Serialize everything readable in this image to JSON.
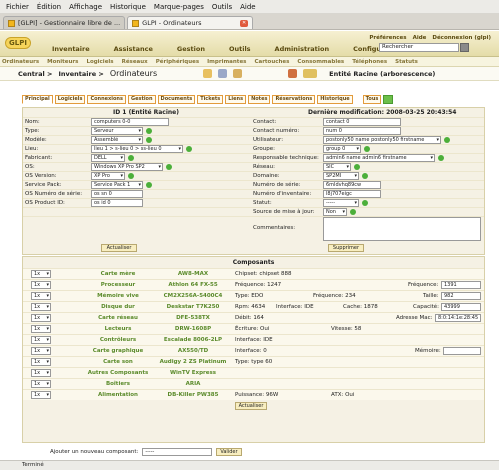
{
  "browser_menu": [
    "Fichier",
    "Édition",
    "Affichage",
    "Historique",
    "Marque-pages",
    "Outils",
    "Aide"
  ],
  "browser_tabs": [
    {
      "title": "[GLPI] - Gestionnaire libre de ..."
    },
    {
      "title": "GLPI - Ordinateurs"
    }
  ],
  "header": {
    "logo": "GLPI",
    "main_nav": [
      "Inventaire",
      "Assistance",
      "Gestion",
      "Outils",
      "Administration",
      "Configuration"
    ],
    "top_links": [
      "Préférences",
      "Aide",
      "Déconnexion (glpi)"
    ],
    "search_placeholder": "Rechercher"
  },
  "subnav": [
    "Ordinateurs",
    "Moniteurs",
    "Logiciels",
    "Réseaux",
    "Périphériques",
    "Imprimantes",
    "Cartouches",
    "Consommables",
    "Téléphones",
    "Statuts"
  ],
  "breadcrumb": {
    "central": "Central >",
    "inventaire": "Inventaire >",
    "section": "Ordinateurs",
    "entity": "Entité Racine (arborescence)"
  },
  "item_tabs": [
    "Principal",
    "Logiciels",
    "Connexions",
    "Gestion",
    "Documents",
    "Tickets",
    "Liens",
    "Notes",
    "Réservations",
    "Historique",
    "Tous"
  ],
  "form": {
    "id_title": "ID 1 (Entité Racine)",
    "last_modified": "Dernière modification: 2008-03-25 20:43:54",
    "left": [
      {
        "label": "Nom:",
        "value": "computers 0-0",
        "kind": "input"
      },
      {
        "label": "Type:",
        "value": "Serveur",
        "kind": "select"
      },
      {
        "label": "Modèle:",
        "value": "Assemblé",
        "kind": "select"
      },
      {
        "label": "Lieu:",
        "value": "lieu 1 > s-lieu 0 > ss-lieu 0",
        "kind": "select"
      },
      {
        "label": "Fabricant:",
        "value": "DELL",
        "kind": "select"
      },
      {
        "label": "OS:",
        "value": "Windows XP Pro SP2",
        "kind": "select"
      },
      {
        "label": "OS Version:",
        "value": "XP Pro",
        "kind": "select"
      },
      {
        "label": "Service Pack:",
        "value": "Service Pack 1",
        "kind": "select"
      },
      {
        "label": "OS Numéro de série:",
        "value": "os sn 0",
        "kind": "input"
      },
      {
        "label": "OS Product ID:",
        "value": "os id 0",
        "kind": "input"
      }
    ],
    "right": [
      {
        "label": "Contact:",
        "value": "contact 0",
        "kind": "input"
      },
      {
        "label": "Contact numéro:",
        "value": "num 0",
        "kind": "input"
      },
      {
        "label": "Utilisateur:",
        "value": "postonly50 name postonly50 firstname",
        "kind": "select"
      },
      {
        "label": "Groupe:",
        "value": "group 0",
        "kind": "select"
      },
      {
        "label": "Responsable technique:",
        "value": "admin6 name admin6 firstname",
        "kind": "select"
      },
      {
        "label": "Réseau:",
        "value": "SIC",
        "kind": "select"
      },
      {
        "label": "Domaine:",
        "value": "SP2MI",
        "kind": "select"
      },
      {
        "label": "Numéro de série:",
        "value": "6mldvhq89cw",
        "kind": "input"
      },
      {
        "label": "Numéro d'inventaire:",
        "value": "l8j707eigc",
        "kind": "input"
      },
      {
        "label": "Statut:",
        "value": "-----",
        "kind": "select"
      },
      {
        "label": "Source de mise à jour:",
        "value": "Non",
        "kind": "select"
      }
    ],
    "comments_label": "Commentaires:",
    "update_button": "Actualiser",
    "delete_button": "Supprimer"
  },
  "components": {
    "title": "Composants",
    "rows": [
      {
        "qty": "1x",
        "type": "Carte mère",
        "name": "AW8-MAX",
        "specs": "Chipset: chipset 888"
      },
      {
        "qty": "1x",
        "type": "Processeur",
        "name": "Athlon 64 FX-55",
        "specs": "Fréquence: 1247",
        "right_label": "Fréquence:",
        "right_value": "1391"
      },
      {
        "qty": "1x",
        "type": "Mémoire vive",
        "name": "CM2X256A-5400C4",
        "specs": "Type: EDO",
        "mid": "Fréquence: 234",
        "right_label": "Taille:",
        "right_value": "982"
      },
      {
        "qty": "1x",
        "type": "Disque dur",
        "name": "Deskstar T7K250",
        "specs": "Rpm: 4634",
        "mid": "Interface: IDE",
        "mid2": "Cache: 1878",
        "right_label": "Capacité:",
        "right_value": "43999"
      },
      {
        "qty": "1x",
        "type": "Carte réseau",
        "name": "DFE-538TX",
        "specs": "Débit: 164",
        "right_label": "Adresse Mac:",
        "right_value": "8:0:14:1e:28:45"
      },
      {
        "qty": "1x",
        "type": "Lecteurs",
        "name": "DRW-1608P",
        "specs": "Écriture: Oui",
        "mid": "Vitesse: 58"
      },
      {
        "qty": "1x",
        "type": "Contrôleurs",
        "name": "Escalade 8006-2LP",
        "specs": "Interface: IDE"
      },
      {
        "qty": "1x",
        "type": "Carte graphique",
        "name": "AX550/TD",
        "specs": "Interface: 0",
        "right_label": "Mémoire:",
        "right_value": ""
      },
      {
        "qty": "1x",
        "type": "Carte son",
        "name": "Audigy 2 ZS Platinum",
        "specs": "Type: type 60"
      },
      {
        "qty": "1x",
        "type": "Autres Composants",
        "name": "WinTV Express",
        "specs": ""
      },
      {
        "qty": "1x",
        "type": "Boîtiers",
        "name": "ARIA",
        "specs": ""
      },
      {
        "qty": "1x",
        "type": "Alimentation",
        "name": "DB-Killer PW385",
        "specs": "Puissance: 96W",
        "mid": "ATX: Oui"
      }
    ],
    "update_button": "Actualiser",
    "add_label": "Ajouter un nouveau composant:",
    "add_select": "-----",
    "add_button": "Valider"
  },
  "status_bar": "Terminé"
}
